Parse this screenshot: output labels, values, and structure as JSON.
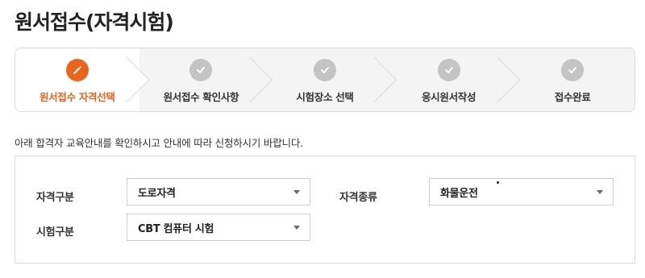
{
  "page": {
    "title": "원서접수(자격시험)"
  },
  "steps": [
    {
      "label": "원서접수 자격선택",
      "state": "current",
      "icon": "pencil-icon"
    },
    {
      "label": "원서접수 확인사항",
      "state": "done",
      "icon": "check-icon"
    },
    {
      "label": "시험장소 선택",
      "state": "done",
      "icon": "check-icon"
    },
    {
      "label": "응시원서작성",
      "state": "done",
      "icon": "check-icon"
    },
    {
      "label": "접수완료",
      "state": "done",
      "icon": "check-icon"
    }
  ],
  "notice": "아래 합격자 교육안내를 확인하시고 안내에 따라 신청하시기 바랍니다.",
  "form": {
    "category_label": "자격구분",
    "category_value": "도로자격",
    "type_label": "자격종류",
    "type_value": "화물운전",
    "exam_label": "시험구분",
    "exam_value": "CBT 컴퓨터 시험"
  },
  "colors": {
    "accent": "#e8651e",
    "done": "#c4c4c4"
  }
}
